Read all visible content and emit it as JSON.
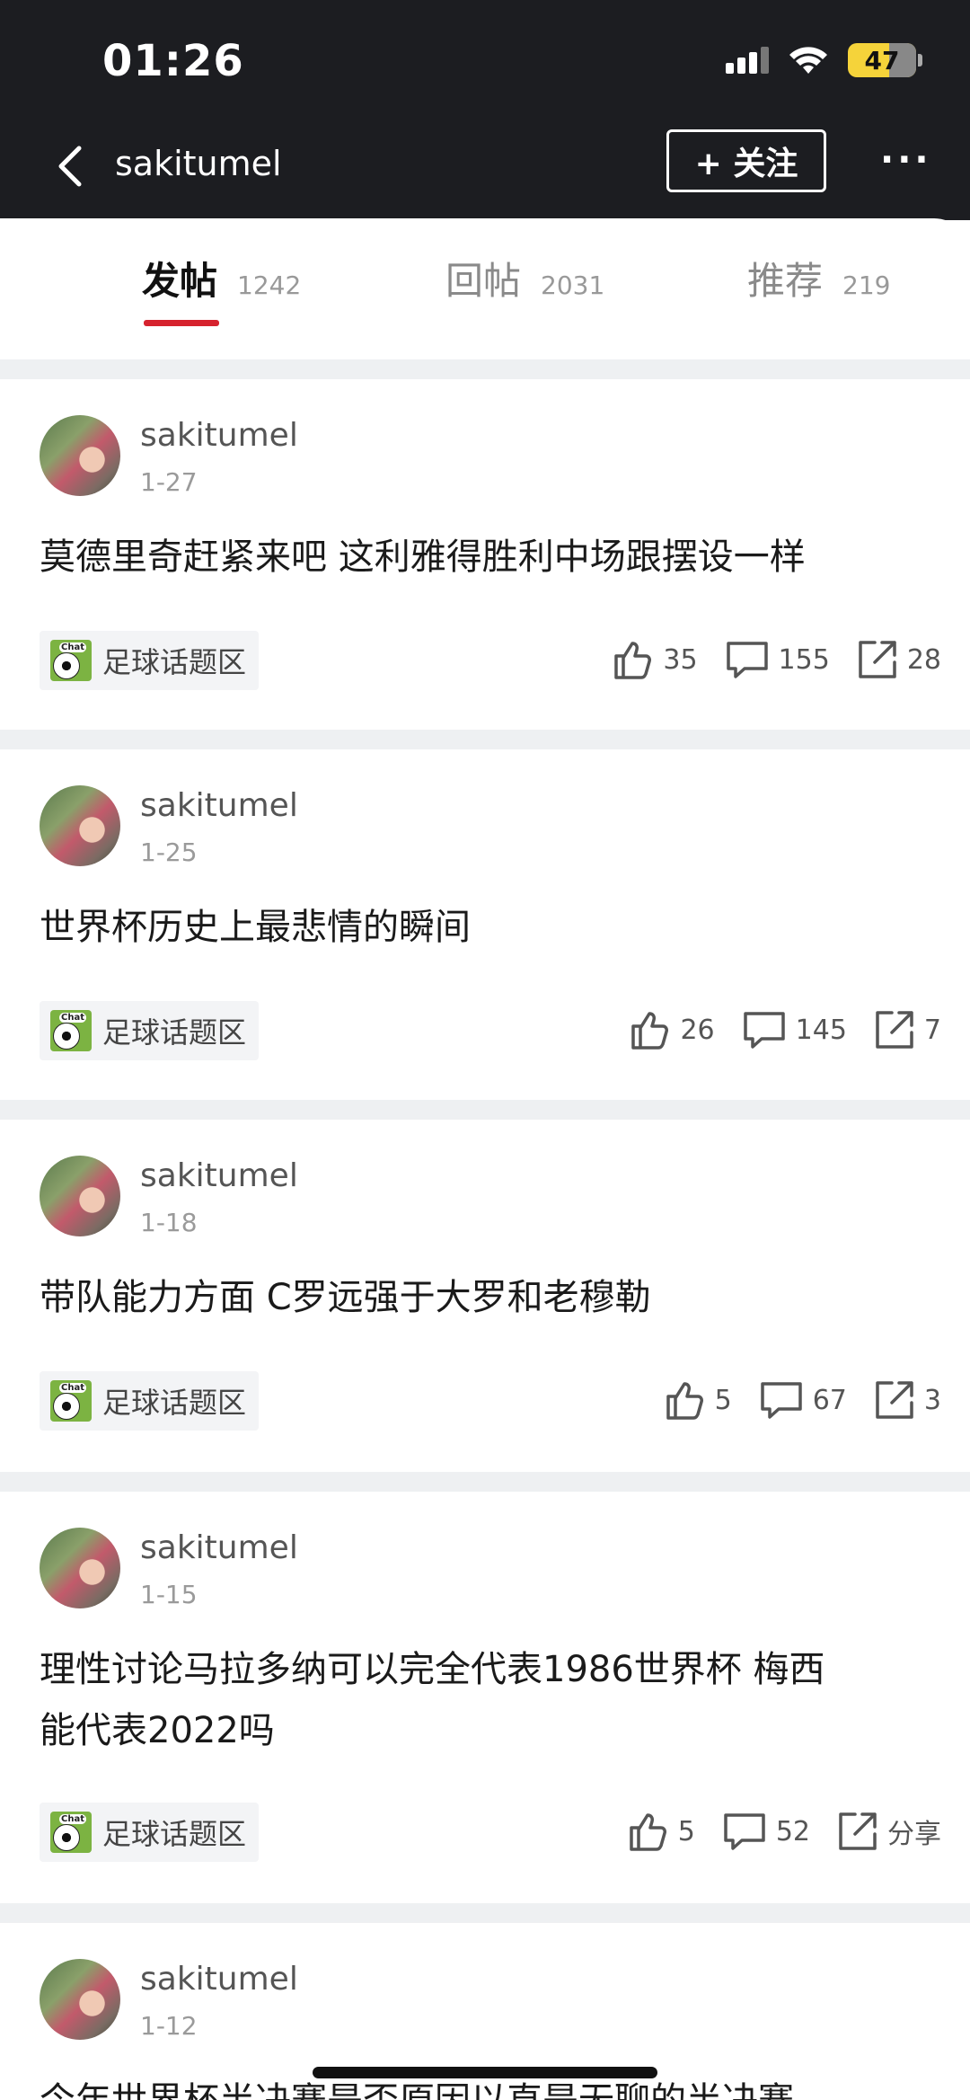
{
  "status_bar": {
    "time": "01:26",
    "battery": "47"
  },
  "nav": {
    "title": "sakitumel",
    "follow_label": "+ 关注",
    "more_label": "···"
  },
  "tabs": [
    {
      "label": "发帖",
      "count": "1242"
    },
    {
      "label": "回帖",
      "count": "2031"
    },
    {
      "label": "推荐",
      "count": "219"
    }
  ],
  "posts": [
    {
      "author": "sakitumel",
      "date": "1-27",
      "title": "莫德里奇赶紧来吧 这利雅得胜利中场跟摆设一样",
      "tag": "足球话题区",
      "likes": "35",
      "comments": "155",
      "shares": "28"
    },
    {
      "author": "sakitumel",
      "date": "1-25",
      "title": "世界杯历史上最悲情的瞬间",
      "tag": "足球话题区",
      "likes": "26",
      "comments": "145",
      "shares": "7"
    },
    {
      "author": "sakitumel",
      "date": "1-18",
      "title": "带队能力方面 C罗远强于大罗和老穆勒",
      "tag": "足球话题区",
      "likes": "5",
      "comments": "67",
      "shares": "3"
    },
    {
      "author": "sakitumel",
      "date": "1-15",
      "title_line1": "理性讨论马拉多纳可以完全代表1986世界杯 梅西",
      "title_line2": "能代表2022吗",
      "tag": "足球话题区",
      "likes": "5",
      "comments": "52",
      "shares": "分享"
    },
    {
      "author": "sakitumel",
      "date": "1-12",
      "title": "今年世界杯半决赛是否原因以直是无聊的半决赛"
    }
  ],
  "tag_icon_text": "Chat"
}
